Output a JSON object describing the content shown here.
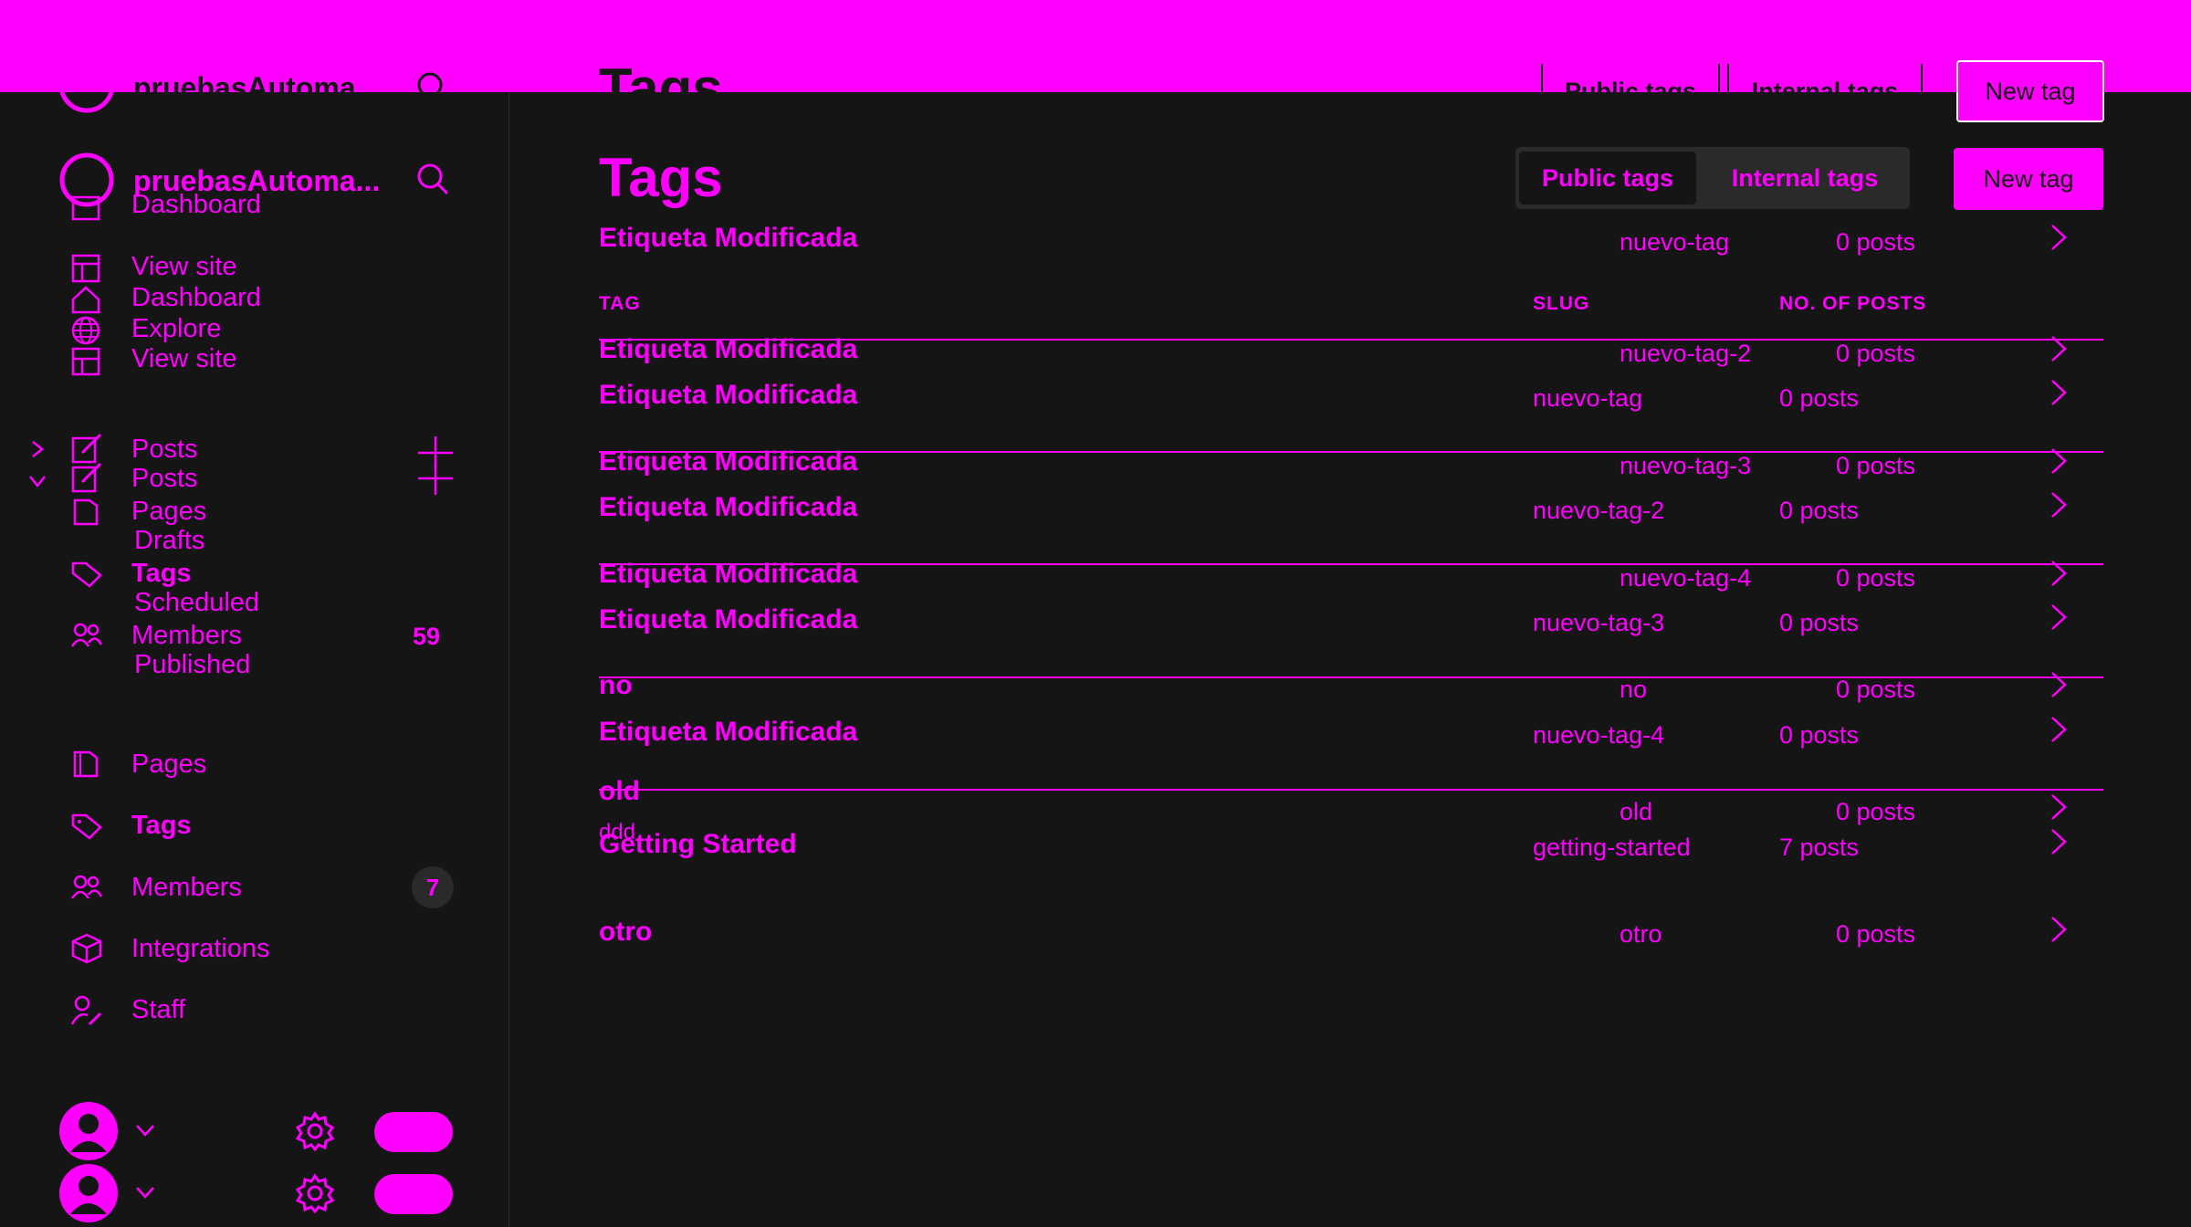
{
  "site": {
    "name": "pruebasAutoma..."
  },
  "sidebar": {
    "ghost_nav": [
      "Dashboard",
      "View site",
      "Dashboard",
      "Explore",
      "View site"
    ],
    "posts_label": "Posts",
    "ghost_posts": [
      "Posts",
      "Pages",
      "Drafts",
      "Tags",
      "Scheduled",
      "Members",
      "Published"
    ],
    "members_count_ghost": "59",
    "items": [
      {
        "label": "Pages"
      },
      {
        "label": "Tags"
      },
      {
        "label": "Members",
        "count": "7"
      },
      {
        "label": "Integrations"
      },
      {
        "label": "Staff"
      }
    ]
  },
  "header": {
    "title": "Tags",
    "public_tags": "Public tags",
    "internal_tags": "Internal tags",
    "new_tag": "New tag"
  },
  "table": {
    "headers": [
      "TAG",
      "SLUG",
      "NO. OF POSTS"
    ],
    "rows": [
      {
        "name": "Etiqueta Modificada",
        "slug": "nuevo-tag",
        "posts": "0 posts"
      },
      {
        "name": "Etiqueta Modificada",
        "slug": "nuevo-tag-2",
        "posts": "0 posts"
      },
      {
        "name": "Etiqueta Modificada",
        "slug": "nuevo-tag-3",
        "posts": "0 posts"
      },
      {
        "name": "Etiqueta Modificada",
        "slug": "nuevo-tag-4",
        "posts": "0 posts"
      },
      {
        "name": "Getting Started",
        "slug": "getting-started",
        "posts": "7 posts"
      }
    ],
    "ghost_rows": [
      {
        "name": "Etiqueta Modificada",
        "slug": "nuevo-tag",
        "posts": "0 posts"
      },
      {
        "name": "Etiqueta Modificada",
        "slug": "nuevo-tag-2",
        "posts": "0 posts"
      },
      {
        "name": "Etiqueta Modificada",
        "slug": "nuevo-tag-3",
        "posts": "0 posts"
      },
      {
        "name": "Etiqueta Modificada",
        "slug": "nuevo-tag-4",
        "posts": "0 posts"
      },
      {
        "name": "no",
        "slug": "no",
        "posts": "0 posts"
      },
      {
        "name": "old",
        "slug": "old",
        "posts": "0 posts"
      },
      {
        "name": "ddd",
        "slug": "",
        "posts": ""
      },
      {
        "name": "otro",
        "slug": "otro",
        "posts": "0 posts"
      }
    ]
  },
  "colors": {
    "accent": "#ff00ff",
    "background": "#151515",
    "segment_bg": "#2a2a2a"
  }
}
